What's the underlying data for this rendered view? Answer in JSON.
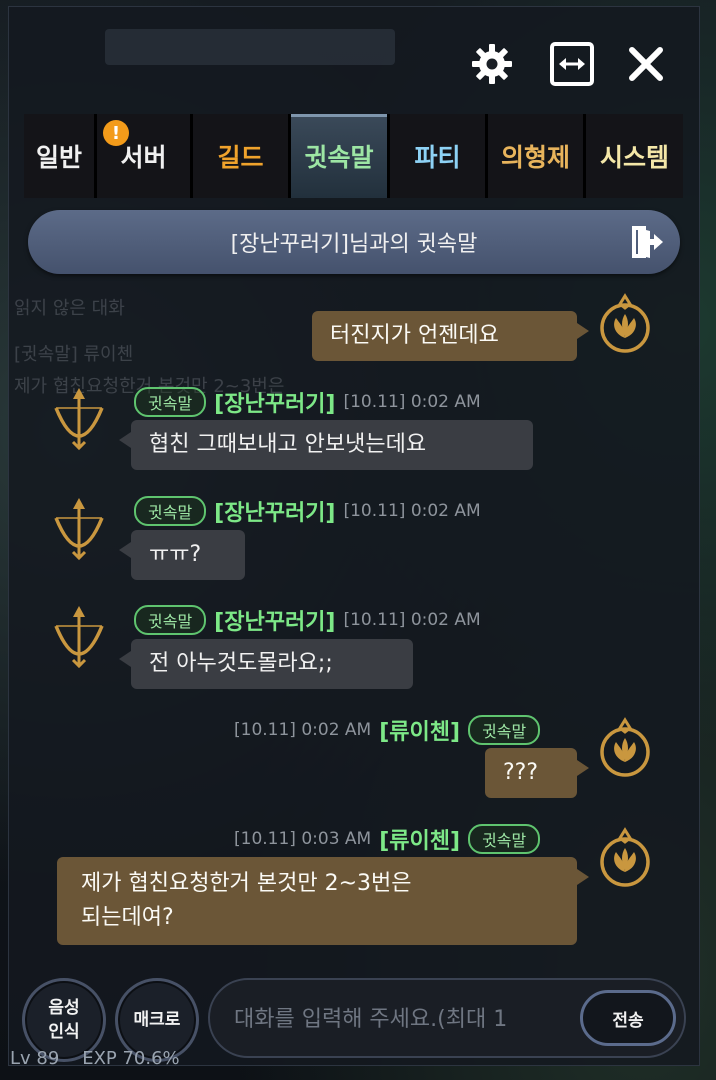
{
  "header": {
    "settings_icon": "gear-icon",
    "resize_icon": "expand-horizontal-icon",
    "close_icon": "close-icon"
  },
  "tabs": [
    {
      "label": "일반",
      "color": "#f0f0f0"
    },
    {
      "label": "서버",
      "color": "#f0f0f0",
      "badge": "!"
    },
    {
      "label": "길드",
      "color": "#f0a32c"
    },
    {
      "label": "귓속말",
      "color": "#9de6a4",
      "active": true
    },
    {
      "label": "파티",
      "color": "#8ed2f5"
    },
    {
      "label": "의형제",
      "color": "#e8b45c"
    },
    {
      "label": "시스템",
      "color": "#f4e7a8"
    }
  ],
  "whisper_bar": {
    "title": "[장난꾸러기]님과의 귓속말",
    "exit_icon": "exit-door-icon"
  },
  "background_ghost": {
    "line1": "읽지 않은 대화",
    "line2": "[귓속말] 류이첸",
    "line3": "제가 협친요청한거 본것만 2~3번은"
  },
  "messages": [
    {
      "side": "out",
      "text": "터진지가 언젠데요",
      "avatar": "lotus-emblem-icon"
    },
    {
      "side": "in",
      "tag": "귓속말",
      "name": "[장난꾸러기]",
      "time": "[10.11] 0:02 AM",
      "text": "협친 그때보내고 안보냇는데요",
      "avatar": "bow-arrow-icon"
    },
    {
      "side": "in",
      "tag": "귓속말",
      "name": "[장난꾸러기]",
      "time": "[10.11] 0:02 AM",
      "text": "ㅠㅠ?",
      "avatar": "bow-arrow-icon"
    },
    {
      "side": "in",
      "tag": "귓속말",
      "name": "[장난꾸러기]",
      "time": "[10.11] 0:02 AM",
      "text": "전 아누것도몰라요;;",
      "avatar": "bow-arrow-icon"
    },
    {
      "side": "out",
      "tag": "귓속말",
      "name": "[류이첸]",
      "time": "[10.11] 0:02 AM",
      "text": "???",
      "avatar": "lotus-emblem-icon"
    },
    {
      "side": "out",
      "tag": "귓속말",
      "name": "[류이첸]",
      "time": "[10.11] 0:03 AM",
      "text_line1": "제가 협친요청한거 본것만 2~3번은",
      "text_line2": "되는데여?",
      "avatar": "lotus-emblem-icon"
    }
  ],
  "bottom": {
    "voice_line1": "음성",
    "voice_line2": "인식",
    "macro": "매크로",
    "input_placeholder": "대화를 입력해 주세요.(최대 1",
    "send": "전송",
    "level": "Lv 89",
    "exp": "EXP 70.6%"
  },
  "colors": {
    "accent_green": "#7de887",
    "bubble_in": "#3a3d43",
    "bubble_out": "#6b5637",
    "gold_icon": "#c9973f"
  }
}
